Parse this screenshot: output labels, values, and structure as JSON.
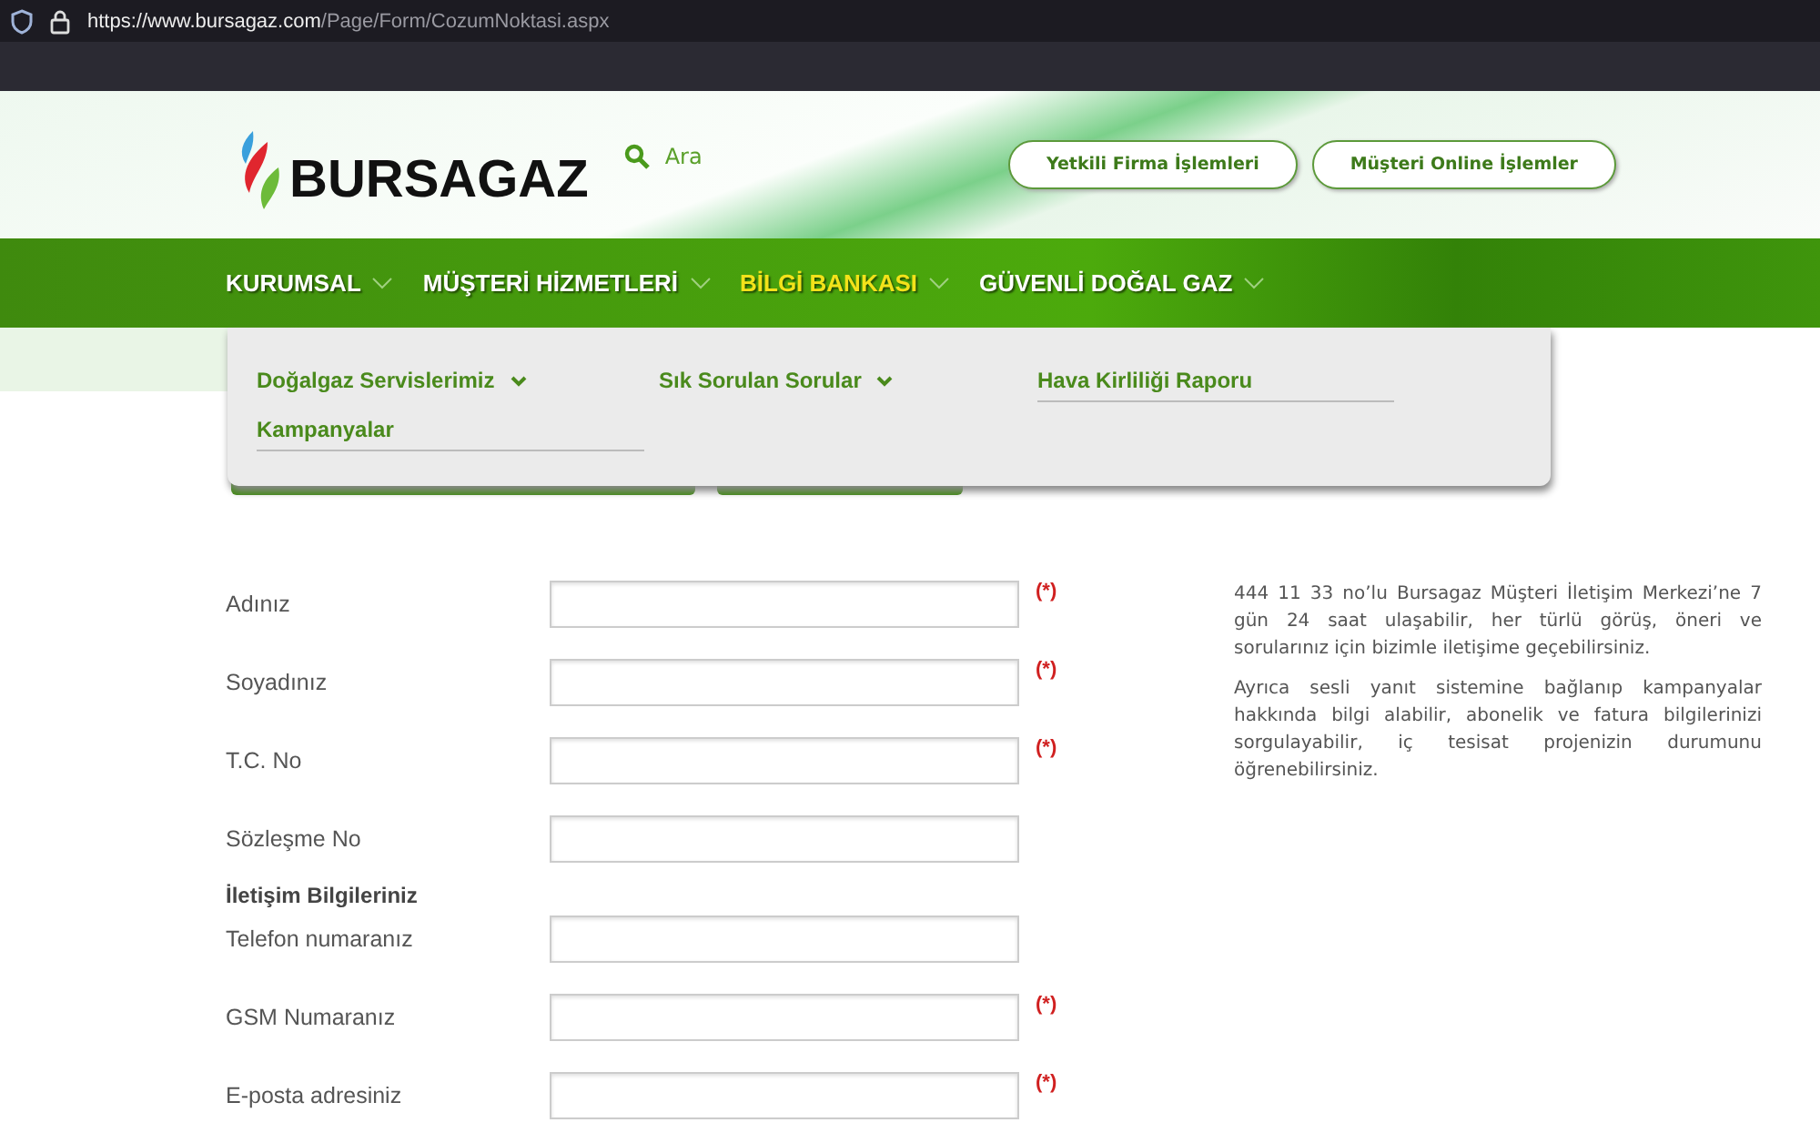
{
  "browser": {
    "url_host": "https://www.bursagaz.com",
    "url_path": "/Page/Form/CozumNoktasi.aspx"
  },
  "header": {
    "logo": "BURSAGAZ",
    "search_label": "Ara",
    "buttons": [
      "Yetkili Firma İşlemleri",
      "Müşteri Online İşlemler"
    ]
  },
  "nav": [
    {
      "label": "KURUMSAL",
      "selected": false
    },
    {
      "label": "MÜŞTERİ HİZMETLERİ",
      "selected": false
    },
    {
      "label": "BİLGİ BANKASI",
      "selected": true
    },
    {
      "label": "GÜVENLİ DOĞAL GAZ",
      "selected": false
    }
  ],
  "dropdown": [
    {
      "label": "Doğalgaz Servislerimiz",
      "expandable": true
    },
    {
      "label": "Sık Sorulan Sorular",
      "expandable": true
    },
    {
      "label": "Hava Kirliliği Raporu",
      "expandable": false
    },
    {
      "label": "Kampanyalar",
      "expandable": false
    }
  ],
  "form": [
    {
      "kind": "field",
      "label": "Adınız",
      "mark": "(*)"
    },
    {
      "kind": "field",
      "label": "Soyadınız",
      "mark": "(*)"
    },
    {
      "kind": "field",
      "label": "T.C. No",
      "mark": "(*)"
    },
    {
      "kind": "field",
      "label": "Sözleşme No"
    },
    {
      "kind": "heading",
      "label": "İletişim Bilgileriniz"
    },
    {
      "kind": "field",
      "label": "Telefon numaranız"
    },
    {
      "kind": "field",
      "label": "GSM Numaranız",
      "mark": "(*)"
    },
    {
      "kind": "field",
      "label": "E-posta adresiniz",
      "mark": "(*)"
    }
  ],
  "info": [
    "444 11 33 no’lu Bursagaz Müşteri İletişim Merkezi’ne 7 gün 24 saat ulaşabilir, her türlü görüş, öneri ve sorularınız için bizimle iletişime geçebilirsiniz.",
    "Ayrıca sesli yanıt sistemine bağlanıp kampanyalar hakkında bilgi alabilir, abonelik ve fatura bilgilerinizi sorgulayabilir, iç tesisat projenizin durumunu öğrenebilirsiniz."
  ]
}
